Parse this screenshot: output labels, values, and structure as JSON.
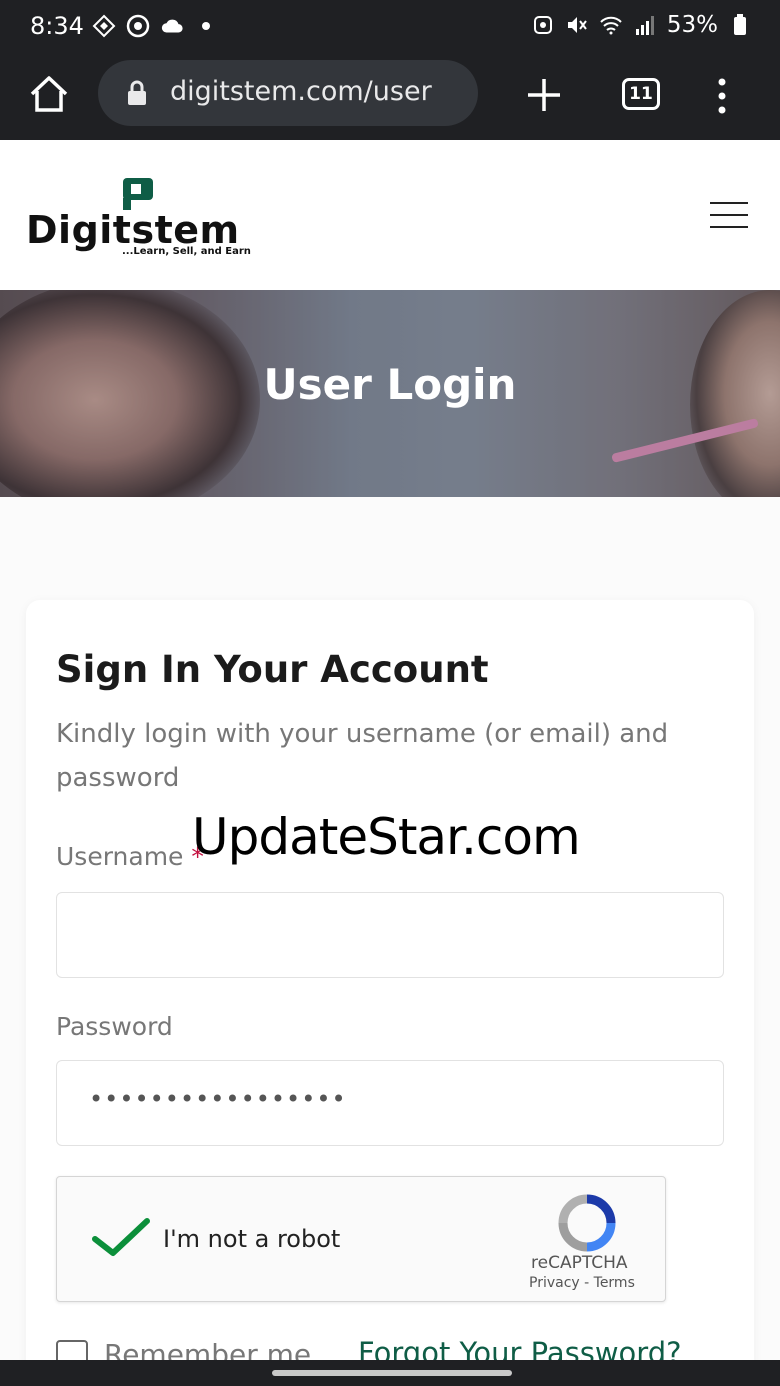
{
  "status_bar": {
    "time": "8:34",
    "battery": "53%"
  },
  "browser": {
    "url": "digitstem.com/user",
    "tab_count": "11"
  },
  "site": {
    "logo_text": "Digitstem",
    "tagline": "...Learn, Sell, and Earn"
  },
  "hero": {
    "title": "User Login"
  },
  "login": {
    "title": "Sign In Your Account",
    "subtitle": "Kindly login with your username (or email) and password",
    "username_label": "Username",
    "required_mark": "*",
    "username_value": "",
    "password_label": "Password",
    "password_value": "•••••••••••••••••",
    "captcha_label": "I'm not a robot",
    "recaptcha_brand": "reCAPTCHA",
    "recaptcha_links": "Privacy - Terms",
    "remember_label": "Remember me",
    "forgot_link": "Forgot Your Password?"
  },
  "watermark": "UpdateStar.com",
  "colors": {
    "brand_green": "#0f5d46",
    "required_red": "#c3103f",
    "captcha_check": "#0b8f3a"
  }
}
